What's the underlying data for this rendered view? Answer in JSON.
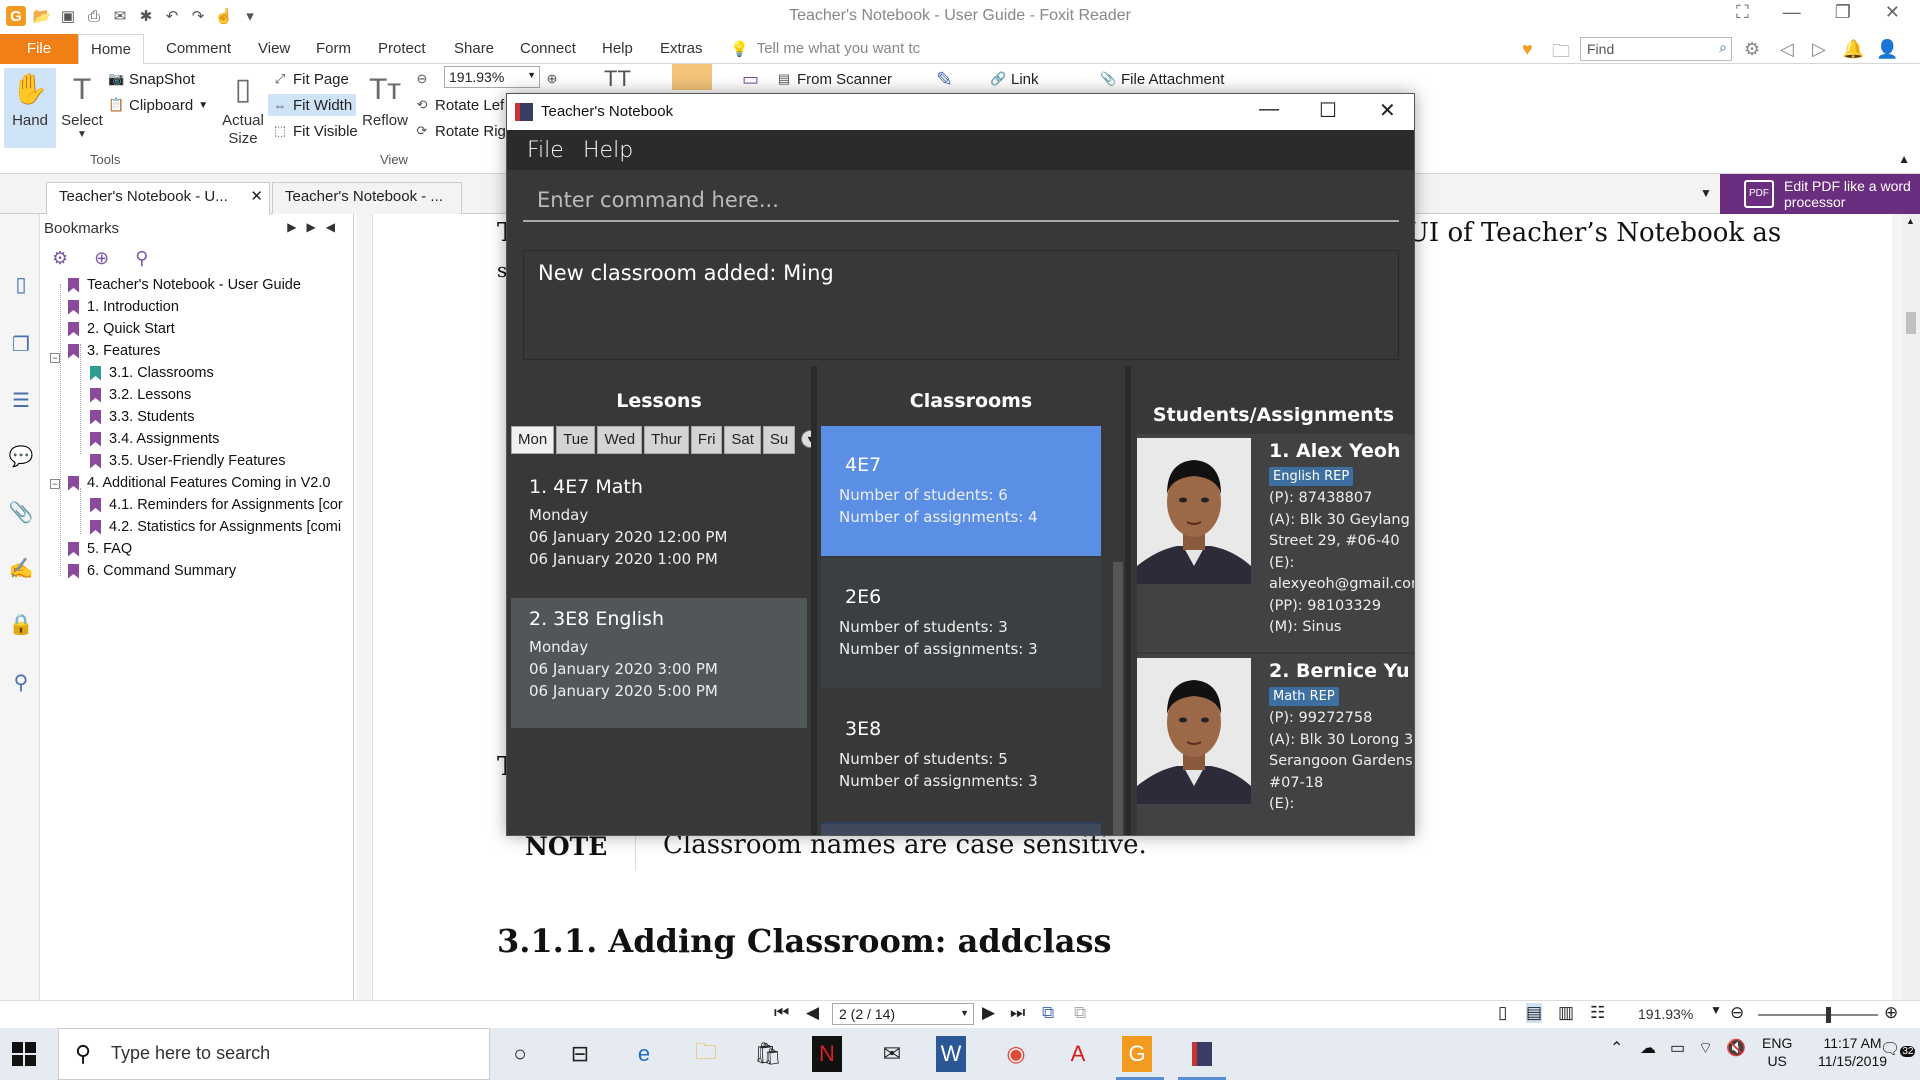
{
  "foxit": {
    "window_title": "Teacher's Notebook - User Guide - Foxit Reader",
    "tabs": [
      "File",
      "Home",
      "Comment",
      "View",
      "Form",
      "Protect",
      "Share",
      "Connect",
      "Help",
      "Extras"
    ],
    "tell_me": "Tell me what you want tc",
    "find_placeholder": "Find",
    "ribbon": {
      "hand": "Hand",
      "select": "Select",
      "snapshot": "SnapShot",
      "clipboard": "Clipboard",
      "tools_group": "Tools",
      "actual_size": "Actual Size",
      "fit_page": "Fit Page",
      "fit_width": "Fit Width",
      "fit_visible": "Fit Visible",
      "reflow": "Reflow",
      "zoom_value": "191.93%",
      "rotate_left": "Rotate Lef",
      "rotate_right": "Rotate Rig",
      "view_group": "View",
      "from_scanner": "From Scanner",
      "link": "Link",
      "file_attachment": "File Attachment"
    },
    "doc_tabs": [
      "Teacher's Notebook - U...",
      "Teacher's Notebook - ..."
    ],
    "promo": "Edit PDF like a word processor",
    "promo_icon": "PDF"
  },
  "bookmarks": {
    "title": "Bookmarks",
    "items": [
      {
        "label": "Teacher's Notebook - User Guide"
      },
      {
        "label": "1. Introduction"
      },
      {
        "label": "2. Quick Start"
      },
      {
        "label": "3. Features"
      },
      {
        "label": "3.1. Classrooms"
      },
      {
        "label": "3.2. Lessons"
      },
      {
        "label": "3.3. Students"
      },
      {
        "label": "3.4. Assignments"
      },
      {
        "label": "3.5. User-Friendly Features"
      },
      {
        "label": "4. Additional Features Coming in V2.0"
      },
      {
        "label": "4.1. Reminders for Assignments [cor"
      },
      {
        "label": "4.2. Statistics for Assignments [comi"
      },
      {
        "label": "5. FAQ"
      },
      {
        "label": "6. Command Summary"
      }
    ]
  },
  "document": {
    "top_line_right": "UI of Teacher’s Notebook as",
    "top_left_char_1": "T",
    "top_left_char_2": "s",
    "mid_left_char": "T",
    "note_label": "NOTE",
    "note_text": "Classroom names are case sensitive.",
    "heading": "3.1.1. Adding Classroom: addclass"
  },
  "status": {
    "page_value": "2 (2 / 14)",
    "zoom": "191.93%"
  },
  "taskbar": {
    "search_placeholder": "Type here to search",
    "lang": "ENG",
    "region": "US",
    "time": "11:17 AM",
    "date": "11/15/2019",
    "notifications": "32"
  },
  "app": {
    "title": "Teacher's Notebook",
    "menu": [
      "File",
      "Help"
    ],
    "command_placeholder": "Enter command here...",
    "result": "New classroom added: Ming",
    "lessons": {
      "title": "Lessons",
      "days": [
        "Mon",
        "Tue",
        "Wed",
        "Thur",
        "Fri",
        "Sat",
        "Su"
      ],
      "items": [
        {
          "name": "1.  4E7 Math",
          "day": "Monday",
          "start": "06 January 2020 12:00 PM",
          "end": "06 January 2020 1:00 PM"
        },
        {
          "name": "2.  3E8 English",
          "day": "Monday",
          "start": "06 January 2020 3:00 PM",
          "end": "06 January 2020 5:00 PM"
        }
      ]
    },
    "classrooms": {
      "title": "Classrooms",
      "items": [
        {
          "name": "4E7",
          "students": "Number of students: 6",
          "assignments": "Number of assignments: 4"
        },
        {
          "name": "2E6",
          "students": "Number of students: 3",
          "assignments": "Number of assignments: 3"
        },
        {
          "name": "3E8",
          "students": "Number of students: 5",
          "assignments": "Number of assignments: 3"
        }
      ]
    },
    "students": {
      "title": "Students/Assignments",
      "items": [
        {
          "name": "1.  Alex Yeoh",
          "tag": "English REP",
          "phone": "(P): 87438807",
          "addr1": "(A): Blk 30 Geylang",
          "addr2": "Street 29, #06-40",
          "email_label": "(E):",
          "email": "alexyeoh@gmail.com",
          "parent_phone": "(PP): 98103329",
          "medical": "(M): Sinus"
        },
        {
          "name": "2.  Bernice Yu",
          "tag": "Math REP",
          "phone": "(P): 99272758",
          "addr1": "(A): Blk 30 Lorong 3",
          "addr2": "Serangoon Gardens,",
          "addr3": "#07-18",
          "email_label": "(E):"
        }
      ]
    }
  }
}
